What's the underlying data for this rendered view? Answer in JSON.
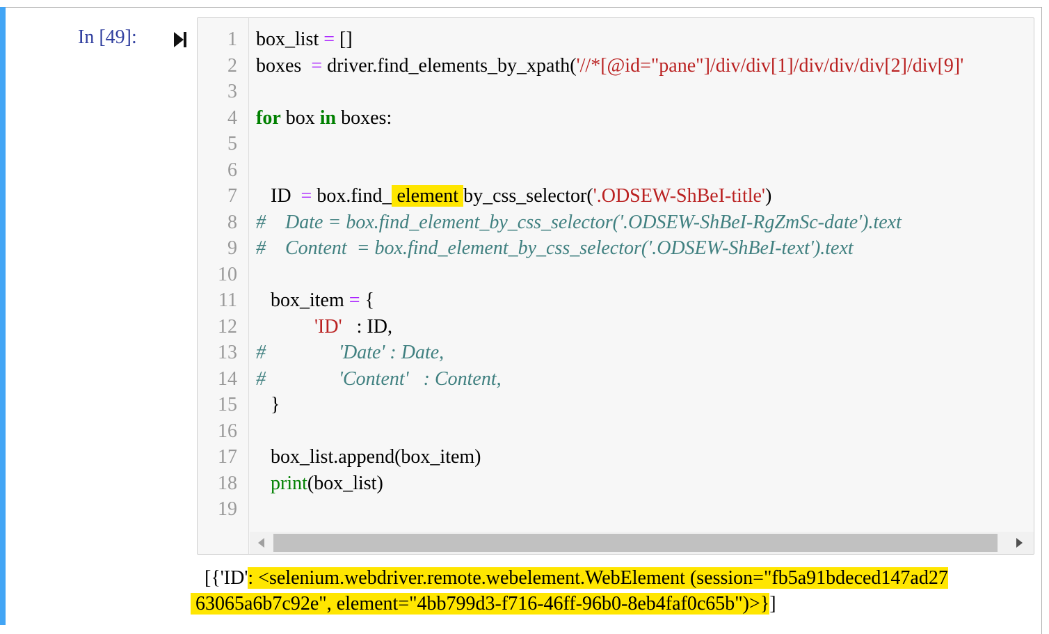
{
  "prompt": "In [49]:",
  "icons": {
    "run": "run-cell-icon",
    "scroll_left": "chevron-left-icon",
    "scroll_right": "chevron-right-icon"
  },
  "colors": {
    "accent_bar": "#42a5f5",
    "prompt": "#303f9f",
    "highlight": "#ffe600",
    "string": "#ba2121",
    "keyword": "#008000",
    "comment": "#408080",
    "operator": "#aa22ff"
  },
  "line_numbers": [
    "1",
    "2",
    "3",
    "4",
    "5",
    "6",
    "7",
    "8",
    "9",
    "10",
    "11",
    "12",
    "13",
    "14",
    "15",
    "16",
    "17",
    "18",
    "19"
  ],
  "code": {
    "l1": {
      "a": "box_list ",
      "op": "=",
      "b": " []"
    },
    "l2": {
      "a": "boxes  ",
      "op": "=",
      "b": " driver.find_elements_by_xpath(",
      "s": "'//*[@id=\"pane\"]/div/div[1]/div/div/div[2]/div[9]'"
    },
    "l4": {
      "kw1": "for",
      "a": " box ",
      "kw2": "in",
      "b": " boxes:"
    },
    "l7": {
      "a": "   ID  ",
      "op": "=",
      "b": " box.find_",
      "hl": " element ",
      "c": "by_css_selector(",
      "s": "'.ODSEW-ShBeI-title'",
      "d": ")"
    },
    "l8": "#    Date = box.find_element_by_css_selector('.ODSEW-ShBeI-RgZmSc-date').text",
    "l9": "#    Content  = box.find_element_by_css_selector('.ODSEW-ShBeI-text').text",
    "l11": {
      "a": "   box_item ",
      "op": "=",
      "b": " {"
    },
    "l12": {
      "a": "            ",
      "s": "'ID'",
      "b": "   : ID,"
    },
    "l13": "#               'Date' : Date,",
    "l14": "#               'Content'   : Content,",
    "l15": "   }",
    "l17": "   box_list.append(box_item)",
    "l18": {
      "a": "   ",
      "bi": "print",
      "b": "(box_list)"
    }
  },
  "output": {
    "l1_pre": "[{'ID'",
    "l1_hl": ": <selenium.webdriver.remote.webelement.WebElement (session=\"fb5a91bdeced147ad27",
    "l2_hl": " 63065a6b7c92e\", element=\"4bb799d3-f716-46ff-96b0-8eb4faf0c65b\")>}",
    "l2_post": "]"
  }
}
